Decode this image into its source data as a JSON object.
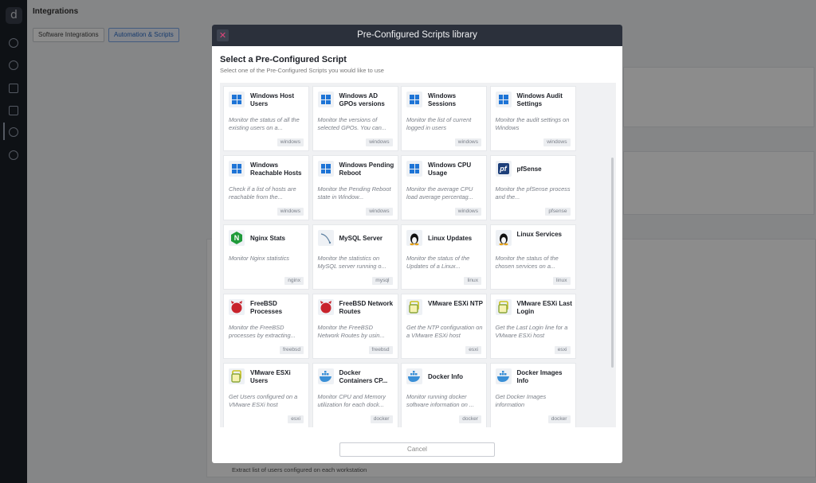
{
  "background": {
    "page_title": "Integrations",
    "tabs": [
      "Software Integrations",
      "Automation & Scripts"
    ],
    "footer_text": "Extract list of users configured on each workstation"
  },
  "modal": {
    "title": "Pre-Configured Scripts library",
    "heading": "Select a Pre-Configured Script",
    "subheading": "Select one of the Pre-Configured Scripts you would like to use",
    "cancel_label": "Cancel",
    "cards": [
      {
        "name": "Windows Host Users",
        "desc": "Monitor the status of all the existing users on a...",
        "tag": "windows",
        "icon": "windows-icon"
      },
      {
        "name": "Windows AD GPOs versions",
        "desc": "Monitor the versions of selected GPOs. You can...",
        "tag": "windows",
        "icon": "windows-icon"
      },
      {
        "name": "Windows Sessions",
        "desc": "Monitor the list of current logged in users",
        "tag": "windows",
        "icon": "windows-icon"
      },
      {
        "name": "Windows Audit Settings",
        "desc": "Monitor the audit settings on Windows",
        "tag": "windows",
        "icon": "windows-icon"
      },
      {
        "name": "Windows Reachable Hosts",
        "desc": "Check if a list of hosts are reachable from the...",
        "tag": "windows",
        "icon": "windows-icon"
      },
      {
        "name": "Windows Pending Reboot",
        "desc": "Monitor the Pending Reboot state in Window...",
        "tag": "windows",
        "icon": "windows-icon"
      },
      {
        "name": "Windows CPU Usage",
        "desc": "Monitor the average CPU load average percentag...",
        "tag": "windows",
        "icon": "windows-icon"
      },
      {
        "name": "pfSense",
        "desc": "Monitor the pfSense process and the...",
        "tag": "pfsense",
        "icon": "pfsense-icon"
      },
      {
        "name": "Nginx Stats",
        "desc": "Monitor Nginx statistics",
        "tag": "nginx",
        "icon": "nginx-icon"
      },
      {
        "name": "MySQL Server",
        "desc": "Monitor the statistics on MySQL server running o...",
        "tag": "mysql",
        "icon": "mysql-icon"
      },
      {
        "name": "Linux Updates",
        "desc": "Monitor the status of the Updates of a Linux...",
        "tag": "linux",
        "icon": "linux-icon"
      },
      {
        "name": "Linux Services",
        "desc": "Monitor the status of the chosen services on a...",
        "tag": "linux",
        "icon": "linux-icon"
      },
      {
        "name": "FreeBSD Processes",
        "desc": "Monitor the FreeBSD processes by extracting...",
        "tag": "freebsd",
        "icon": "freebsd-icon"
      },
      {
        "name": "FreeBSD Network Routes",
        "desc": "Monitor the FreeBSD Network Routes by usin...",
        "tag": "freebsd",
        "icon": "freebsd-icon"
      },
      {
        "name": "VMware ESXi NTP",
        "desc": "Get the NTP configuration on a VMware ESXi host",
        "tag": "esxi",
        "icon": "vmware-icon"
      },
      {
        "name": "VMware ESXi Last Login",
        "desc": "Get the Last Login line for a VMware ESXi host",
        "tag": "esxi",
        "icon": "vmware-icon"
      },
      {
        "name": "VMware ESXi Users",
        "desc": "Get Users configured on a VMware ESXi host",
        "tag": "esxi",
        "icon": "vmware-icon"
      },
      {
        "name": "Docker Containers CP...",
        "desc": "Monitor CPU and Memory utilization for each dock...",
        "tag": "docker",
        "icon": "docker-icon"
      },
      {
        "name": "Docker Info",
        "desc": "Monitor running docker software information on ...",
        "tag": "docker",
        "icon": "docker-icon"
      },
      {
        "name": "Docker Images Info",
        "desc": "Get Docker Images information",
        "tag": "docker",
        "icon": "docker-icon"
      }
    ]
  },
  "colors": {
    "windows": "#1e74d6",
    "freebsd": "#c8232c",
    "nginx": "#1f9a3a",
    "vmware": "#c9c21c",
    "docker": "#3a8fd6",
    "header": "#2b303b",
    "close": "#e0457b"
  }
}
